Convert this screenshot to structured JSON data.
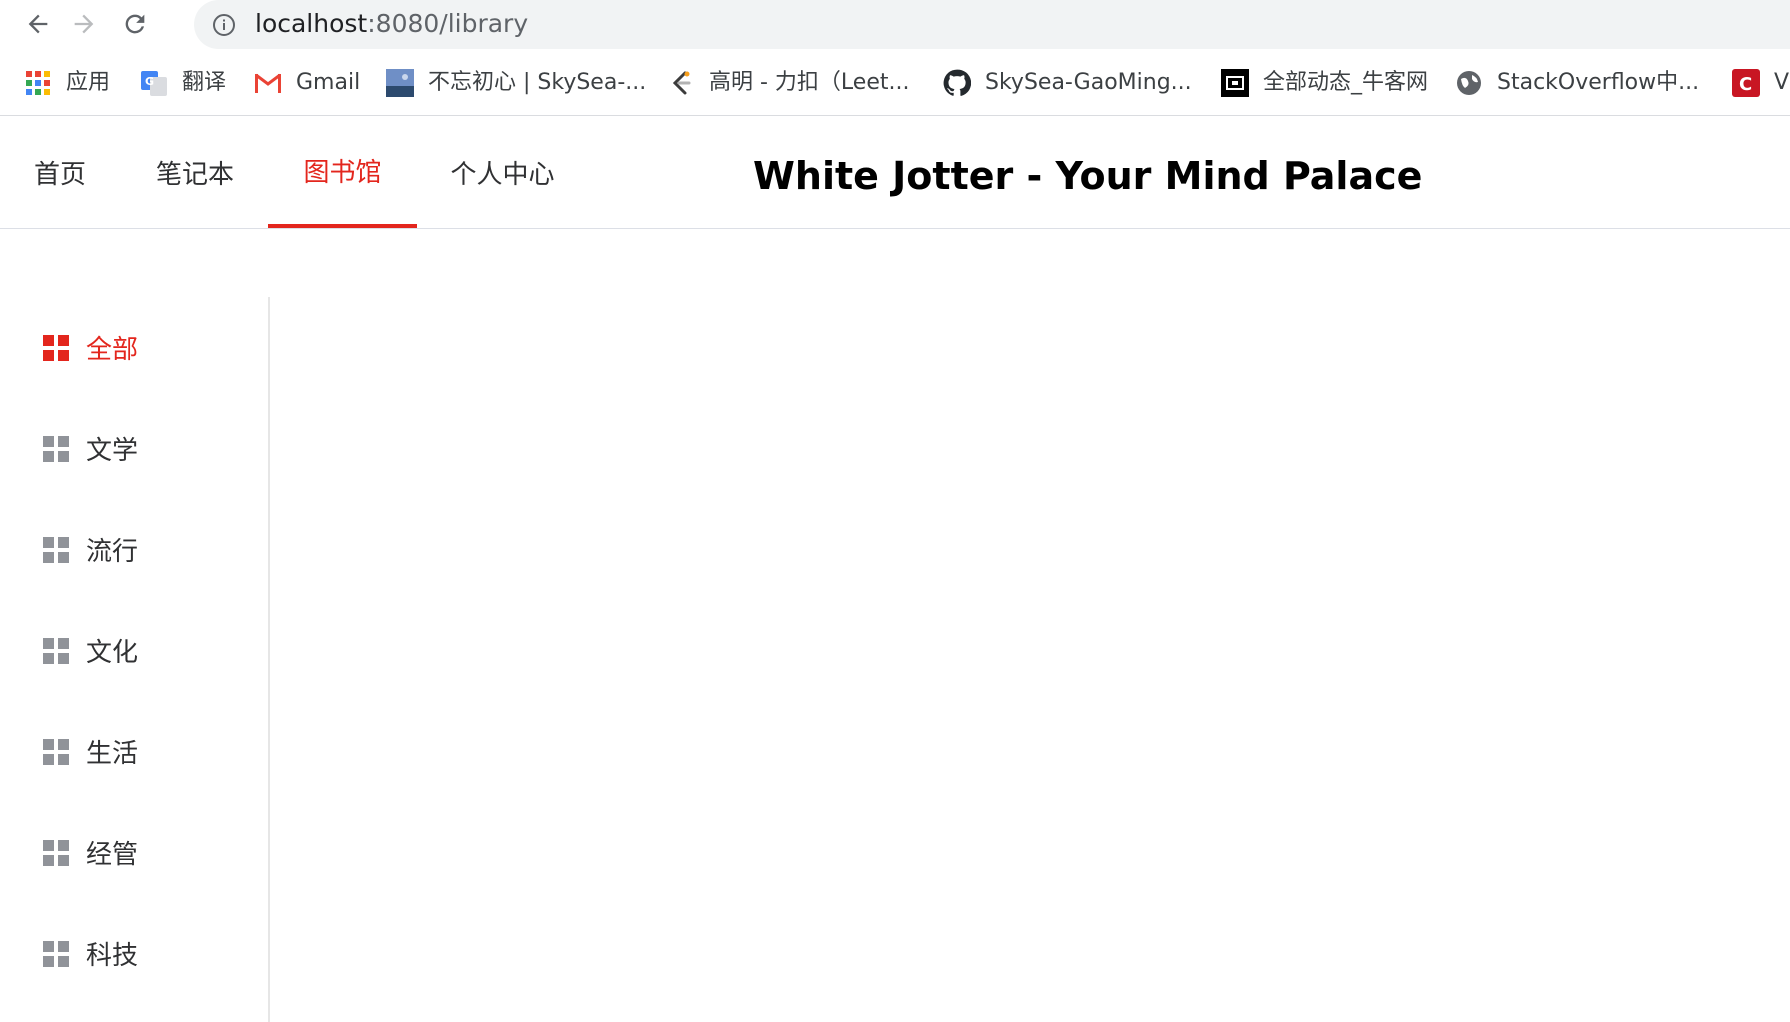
{
  "browser": {
    "url_host": "localhost",
    "url_rest": ":8080/library",
    "icons": {
      "back": "arrow-left-icon",
      "forward": "arrow-right-icon",
      "reload": "reload-icon",
      "info": "info-icon"
    }
  },
  "bookmarks": [
    {
      "label": "应用",
      "icon": "apps-grid-icon"
    },
    {
      "label": "翻译",
      "icon": "google-translate-icon"
    },
    {
      "label": "Gmail",
      "icon": "gmail-icon"
    },
    {
      "label": "不忘初心 | SkySea-...",
      "icon": "landscape-thumbnail-icon"
    },
    {
      "label": "高明 - 力扣（Leet...",
      "icon": "leetcode-icon"
    },
    {
      "label": "SkySea-GaoMing...",
      "icon": "github-icon"
    },
    {
      "label": "全部动态_牛客网",
      "icon": "nowcoder-icon"
    },
    {
      "label": "StackOverflow中...",
      "icon": "globe-icon"
    },
    {
      "label": "V",
      "icon": "csdn-icon"
    }
  ],
  "nav": {
    "tabs": [
      {
        "label": "首页"
      },
      {
        "label": "笔记本"
      },
      {
        "label": "图书馆",
        "active": true
      },
      {
        "label": "个人中心"
      }
    ],
    "title": "White Jotter - Your Mind Palace"
  },
  "sidebar": {
    "items": [
      {
        "label": "全部",
        "active": true
      },
      {
        "label": "文学"
      },
      {
        "label": "流行"
      },
      {
        "label": "文化"
      },
      {
        "label": "生活"
      },
      {
        "label": "经管"
      },
      {
        "label": "科技"
      }
    ]
  },
  "colors": {
    "accent": "#e3261d",
    "icon_gray": "#909399",
    "text": "#303133"
  }
}
